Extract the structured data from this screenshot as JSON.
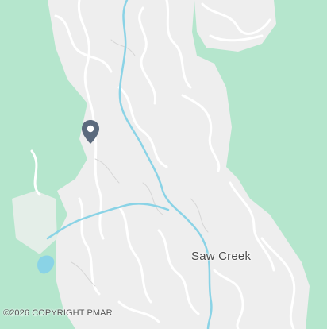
{
  "map": {
    "place_label": "Saw Creek",
    "copyright": "©2026 COPYRIGHT PMAR",
    "marker_icon": "map-pin-icon",
    "colors": {
      "forest": "#b5e6cd",
      "developed": "#eeeeee",
      "road": "#ffffff",
      "road_edge": "#d6d6d6",
      "water": "#8ad3e6",
      "pin": "#5b6a7d"
    }
  }
}
